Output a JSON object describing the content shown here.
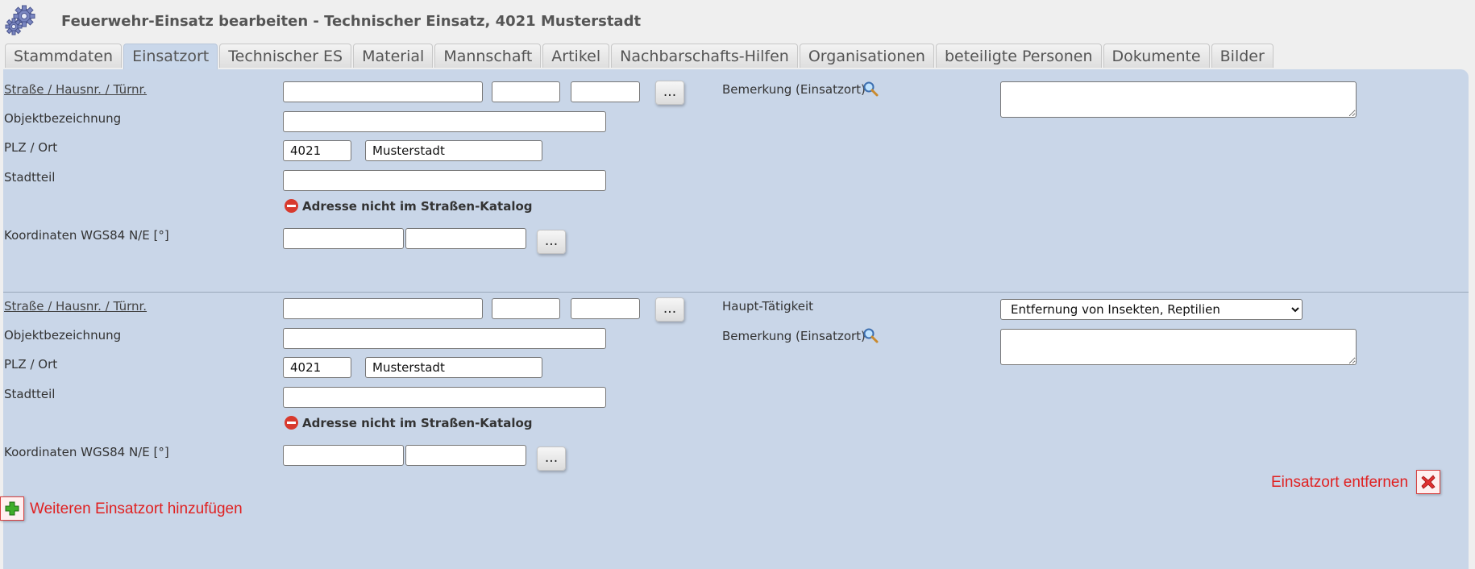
{
  "header": {
    "title": "Feuerwehr-Einsatz bearbeiten - Technischer Einsatz, 4021 Musterstadt",
    "icon": "gears-icon"
  },
  "tabs": [
    {
      "label": "Stammdaten",
      "active": false
    },
    {
      "label": "Einsatzort",
      "active": true
    },
    {
      "label": "Technischer ES",
      "active": false
    },
    {
      "label": "Material",
      "active": false
    },
    {
      "label": "Mannschaft",
      "active": false
    },
    {
      "label": "Artikel",
      "active": false
    },
    {
      "label": "Nachbarschafts-Hilfen",
      "active": false
    },
    {
      "label": "Organisationen",
      "active": false
    },
    {
      "label": "beteiligte Personen",
      "active": false
    },
    {
      "label": "Dokumente",
      "active": false
    },
    {
      "label": "Bilder",
      "active": false
    }
  ],
  "locations": [
    {
      "street_label": "Straße / Hausnr. / Türnr.",
      "street": "",
      "house_no": "",
      "door_no": "",
      "lookup_label": "...",
      "object_label": "Objektbezeichnung",
      "object": "",
      "zip_city_label": "PLZ / Ort",
      "zip": "4021",
      "city": "Musterstadt",
      "district_label": "Stadtteil",
      "district": "",
      "warning": "Adresse nicht im Straßen-Katalog",
      "coords_label": "Koordinaten WGS84 N/E [°]",
      "lat": "",
      "lon": "",
      "coords_button": "...",
      "remark_label": "Bemerkung (Einsatzort)",
      "remark": ""
    },
    {
      "street_label": "Straße / Hausnr. / Türnr.",
      "street": "",
      "house_no": "",
      "door_no": "",
      "lookup_label": "...",
      "object_label": "Objektbezeichnung",
      "object": "",
      "zip_city_label": "PLZ / Ort",
      "zip": "4021",
      "city": "Musterstadt",
      "district_label": "Stadtteil",
      "district": "",
      "warning": "Adresse nicht im Straßen-Katalog",
      "coords_label": "Koordinaten WGS84 N/E [°]",
      "lat": "",
      "lon": "",
      "coords_button": "...",
      "activity_label": "Haupt-Tätigkeit",
      "activity": "Entfernung von Insekten, Reptilien",
      "remark_label": "Bemerkung (Einsatzort)",
      "remark": ""
    }
  ],
  "actions": {
    "remove_label": "Einsatzort entfernen",
    "add_label": "Weiteren Einsatzort hinzufügen"
  },
  "colors": {
    "panel": "#c9d6e8",
    "link_red": "#e02020",
    "warning_red": "#d83a2e",
    "add_green": "#3fae2a"
  }
}
